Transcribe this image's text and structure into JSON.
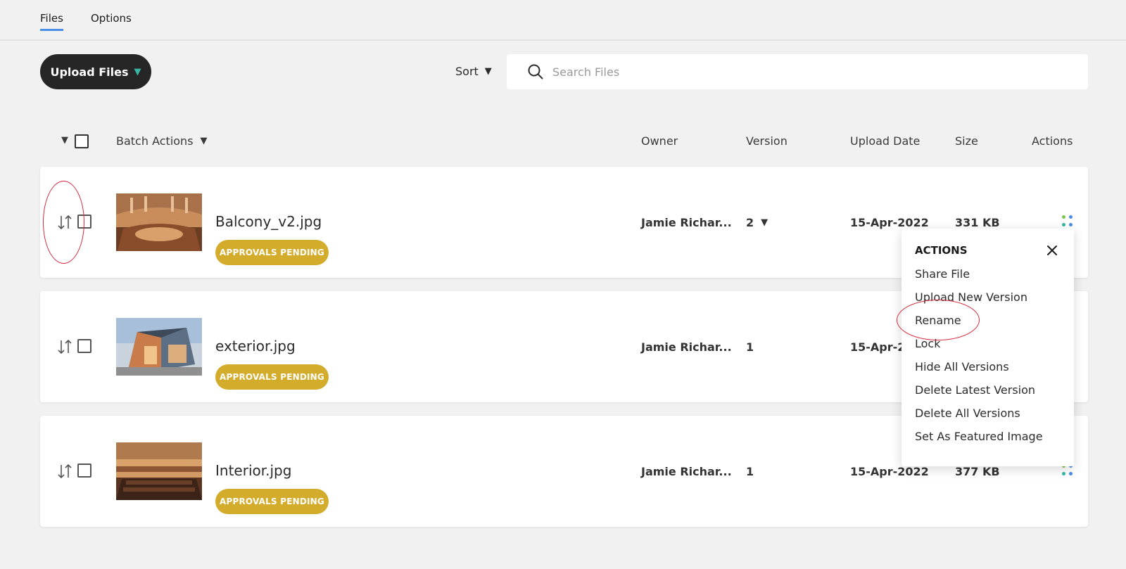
{
  "tabs": [
    {
      "label": "Files",
      "active": true
    },
    {
      "label": "Options",
      "active": false
    }
  ],
  "toolbar": {
    "upload_label": "Upload Files",
    "sort_label": "Sort",
    "search_placeholder": "Search Files"
  },
  "table": {
    "batch_actions": "Batch Actions",
    "columns": [
      "Owner",
      "Version",
      "Upload Date",
      "Size",
      "Actions"
    ]
  },
  "rows": [
    {
      "name": "Balcony_v2.jpg",
      "badge": "APPROVALS PENDING",
      "owner": "Jamie Richar...",
      "version": "2",
      "date": "15-Apr-2022",
      "size": "331 KB"
    },
    {
      "name": "exterior.jpg",
      "badge": "APPROVALS PENDING",
      "owner": "Jamie Richar...",
      "version": "1",
      "date": "15-Apr-2",
      "size": ""
    },
    {
      "name": "Interior.jpg",
      "badge": "APPROVALS PENDING",
      "owner": "Jamie Richar...",
      "version": "1",
      "date": "15-Apr-2022",
      "size": "377 KB"
    }
  ],
  "actions_menu": {
    "title": "ACTIONS",
    "items": [
      "Share File",
      "Upload New Version",
      "Rename",
      "Lock",
      "Hide All Versions",
      "Delete Latest Version",
      "Delete All Versions",
      "Set As Featured Image"
    ]
  },
  "colors": {
    "accent_tab": "#4a8ee6",
    "upload_button": "#262626",
    "upload_caret": "#37b6a5",
    "badge": "#d3ac2c",
    "annotation": "#d6273a"
  }
}
